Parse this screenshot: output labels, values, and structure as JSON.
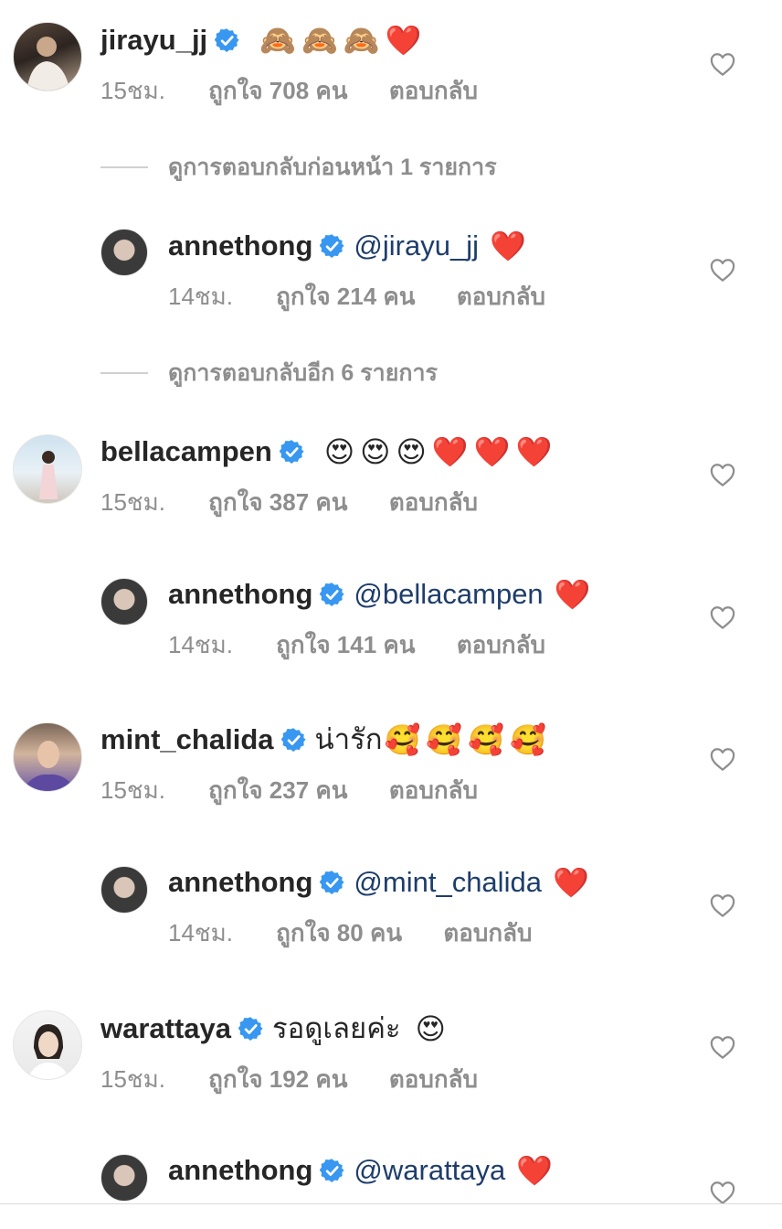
{
  "comments": [
    {
      "user": "jirayu_jj",
      "text": "",
      "emoji": "🙈🙈🙈❤️",
      "time": "15ชม.",
      "likes": "ถูกใจ 708 คน",
      "reply": "ตอบกลับ"
    },
    {
      "user": "annethong",
      "mention": "@jirayu_jj",
      "emoji": "❤️",
      "time": "14ชม.",
      "likes": "ถูกใจ 214 คน",
      "reply": "ตอบกลับ"
    },
    {
      "user": "bellacampen",
      "text": "",
      "emoji": "😍😍😍❤️❤️❤️",
      "time": "15ชม.",
      "likes": "ถูกใจ 387 คน",
      "reply": "ตอบกลับ"
    },
    {
      "user": "annethong",
      "mention": "@bellacampen",
      "emoji": "❤️",
      "time": "14ชม.",
      "likes": "ถูกใจ 141 คน",
      "reply": "ตอบกลับ"
    },
    {
      "user": "mint_chalida",
      "text": "น่ารัก",
      "emoji": "🥰🥰🥰🥰",
      "time": "15ชม.",
      "likes": "ถูกใจ 237 คน",
      "reply": "ตอบกลับ"
    },
    {
      "user": "annethong",
      "mention": "@mint_chalida",
      "emoji": "❤️",
      "time": "14ชม.",
      "likes": "ถูกใจ 80 คน",
      "reply": "ตอบกลับ"
    },
    {
      "user": "warattaya",
      "text": "รอดูเลยค่ะ",
      "emoji": "😍",
      "time": "15ชม.",
      "likes": "ถูกใจ 192 คน",
      "reply": "ตอบกลับ"
    },
    {
      "user": "annethong",
      "mention": "@warattaya",
      "emoji": "❤️"
    }
  ],
  "view_replies": [
    {
      "label": "ดูการตอบกลับก่อนหน้า 1 รายการ"
    },
    {
      "label": "ดูการตอบกลับอีก 6 รายการ"
    }
  ],
  "colors": {
    "verified": "#3897f0",
    "meta": "#8e8e8e",
    "mention": "#1e3d6b",
    "heart": "#e0245e"
  },
  "icons": {
    "verified": "verified-badge-icon",
    "like": "heart-outline-icon"
  }
}
